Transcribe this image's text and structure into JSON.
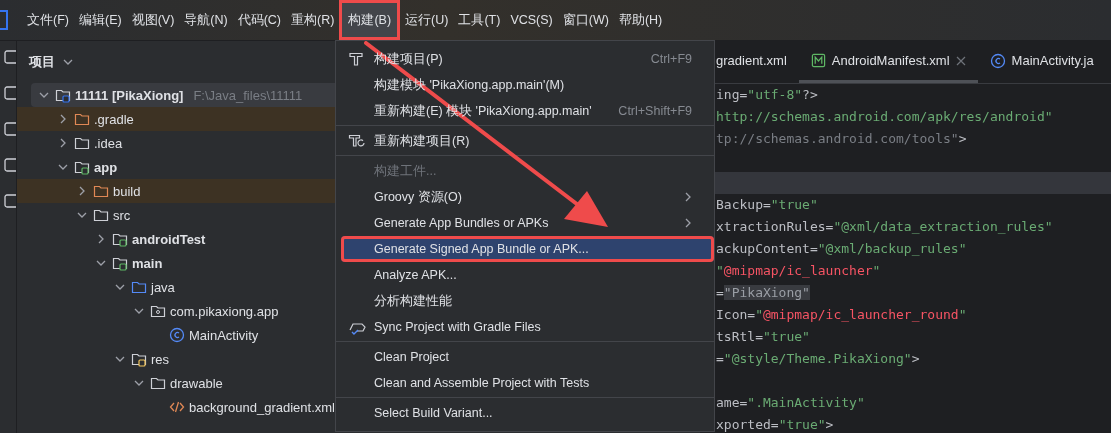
{
  "menubar": {
    "items": [
      {
        "label": "文件(F)",
        "selected": false,
        "annotated": false
      },
      {
        "label": "编辑(E)",
        "selected": false,
        "annotated": false
      },
      {
        "label": "视图(V)",
        "selected": false,
        "annotated": false
      },
      {
        "label": "导航(N)",
        "selected": false,
        "annotated": false
      },
      {
        "label": "代码(C)",
        "selected": false,
        "annotated": false
      },
      {
        "label": "重构(R)",
        "selected": false,
        "annotated": false
      },
      {
        "label": "构建(B)",
        "selected": true,
        "annotated": true
      },
      {
        "label": "运行(U)",
        "selected": false,
        "annotated": false
      },
      {
        "label": "工具(T)",
        "selected": false,
        "annotated": false
      },
      {
        "label": "VCS(S)",
        "selected": false,
        "annotated": false
      },
      {
        "label": "窗口(W)",
        "selected": false,
        "annotated": false
      },
      {
        "label": "帮助(H)",
        "selected": false,
        "annotated": false
      }
    ]
  },
  "project_panel": {
    "title": "项目",
    "tree": [
      {
        "label": "11111 [PikaXiong]",
        "path": "F:\\Java_files\\11111",
        "kind": "project",
        "bold": true,
        "expanded": true,
        "selected": true,
        "excluded": false,
        "children": [
          {
            "label": ".gradle",
            "kind": "folder",
            "bold": false,
            "expanded": false,
            "selected": false,
            "excluded": true
          },
          {
            "label": ".idea",
            "kind": "folder",
            "bold": false,
            "expanded": false,
            "selected": false,
            "excluded": false
          },
          {
            "label": "app",
            "kind": "module",
            "bold": true,
            "expanded": true,
            "selected": false,
            "excluded": false,
            "children": [
              {
                "label": "build",
                "kind": "folder",
                "bold": false,
                "expanded": false,
                "selected": false,
                "excluded": true
              },
              {
                "label": "src",
                "kind": "folder",
                "bold": false,
                "expanded": true,
                "selected": false,
                "excluded": false,
                "children": [
                  {
                    "label": "androidTest",
                    "kind": "module",
                    "bold": true,
                    "expanded": false,
                    "selected": false,
                    "excluded": false
                  },
                  {
                    "label": "main",
                    "kind": "module",
                    "bold": true,
                    "expanded": true,
                    "selected": false,
                    "excluded": false,
                    "children": [
                      {
                        "label": "java",
                        "kind": "source",
                        "bold": false,
                        "expanded": true,
                        "selected": false,
                        "excluded": false,
                        "children": [
                          {
                            "label": "com.pikaxiong.app",
                            "kind": "package",
                            "bold": false,
                            "expanded": true,
                            "selected": false,
                            "excluded": false,
                            "children": [
                              {
                                "label": "MainActivity",
                                "kind": "class",
                                "bold": false,
                                "selected": false,
                                "excluded": false
                              }
                            ]
                          }
                        ]
                      },
                      {
                        "label": "res",
                        "kind": "resources",
                        "bold": false,
                        "expanded": true,
                        "selected": false,
                        "excluded": false,
                        "children": [
                          {
                            "label": "drawable",
                            "kind": "folder",
                            "bold": false,
                            "expanded": true,
                            "selected": false,
                            "excluded": false,
                            "children": [
                              {
                                "label": "background_gradient.xml",
                                "kind": "xml",
                                "bold": false,
                                "selected": false,
                                "excluded": false
                              }
                            ]
                          }
                        ]
                      }
                    ]
                  }
                ]
              }
            ]
          }
        ]
      }
    ]
  },
  "editor": {
    "tabs": [
      {
        "label": "gradient.xml",
        "kind": "plain",
        "selected": false,
        "closable": false
      },
      {
        "label": "AndroidManifest.xml",
        "kind": "manifest",
        "selected": true,
        "closable": true
      },
      {
        "label": "MainActivity.ja",
        "kind": "class",
        "selected": false,
        "closable": false
      }
    ],
    "lines": [
      {
        "current": false,
        "segments": [
          {
            "kind": "attr",
            "text": "ing="
          },
          {
            "kind": "str",
            "text": "\"utf-8\""
          },
          {
            "kind": "punct",
            "text": "?>"
          }
        ]
      },
      {
        "current": false,
        "segments": [
          {
            "kind": "str",
            "text": "http://schemas.android.com/apk/res/android\""
          }
        ]
      },
      {
        "current": false,
        "segments": [
          {
            "kind": "unused",
            "text": "tp://schemas.android.com/tools\""
          },
          {
            "kind": "punct",
            "text": ">"
          }
        ]
      },
      {
        "current": false
      },
      {
        "current": true
      },
      {
        "current": false,
        "segments": [
          {
            "kind": "attr",
            "text": "Backup="
          },
          {
            "kind": "str",
            "text": "\"true\""
          }
        ]
      },
      {
        "current": false,
        "segments": [
          {
            "kind": "attr",
            "text": "xtractionRules="
          },
          {
            "kind": "str",
            "text": "\"@xml/data_extraction_rules\""
          }
        ]
      },
      {
        "current": false,
        "segments": [
          {
            "kind": "attr",
            "text": "ackupContent="
          },
          {
            "kind": "str",
            "text": "\"@xml/backup_rules\""
          }
        ]
      },
      {
        "current": false,
        "segments": [
          {
            "kind": "str",
            "text": "\""
          },
          {
            "kind": "ref",
            "text": "@mipmap/ic_launcher"
          },
          {
            "kind": "str",
            "text": "\""
          }
        ]
      },
      {
        "current": false,
        "segments": [
          {
            "kind": "attr",
            "text": "="
          },
          {
            "kind": "folded",
            "text": "\"PikaXiong\""
          }
        ]
      },
      {
        "current": false,
        "segments": [
          {
            "kind": "attr",
            "text": "Icon="
          },
          {
            "kind": "str",
            "text": "\""
          },
          {
            "kind": "ref",
            "text": "@mipmap/ic_launcher_round"
          },
          {
            "kind": "str",
            "text": "\""
          }
        ]
      },
      {
        "current": false,
        "segments": [
          {
            "kind": "attr",
            "text": "tsRtl="
          },
          {
            "kind": "str",
            "text": "\"true\""
          }
        ]
      },
      {
        "current": false,
        "segments": [
          {
            "kind": "attr",
            "text": "="
          },
          {
            "kind": "str",
            "text": "\"@style/Theme.PikaXiong\""
          },
          {
            "kind": "punct",
            "text": ">"
          }
        ]
      },
      {
        "current": false
      },
      {
        "current": false,
        "segments": [
          {
            "kind": "attr",
            "text": "ame="
          },
          {
            "kind": "str",
            "text": "\".MainActivity\""
          }
        ]
      },
      {
        "current": false,
        "segments": [
          {
            "kind": "attr",
            "text": "xported="
          },
          {
            "kind": "str",
            "text": "\"true\""
          },
          {
            "kind": "punct",
            "text": ">"
          }
        ]
      }
    ]
  },
  "build_menu": {
    "items": [
      {
        "kind": "build",
        "label": "构建项目(P)",
        "shortcut": "Ctrl+F9",
        "disabled": false,
        "submenu": false,
        "selected": false,
        "annotated": false
      },
      {
        "kind": "plain",
        "label": "构建模块 'PikaXiong.app.main'(M)",
        "disabled": false,
        "submenu": false,
        "selected": false,
        "annotated": false
      },
      {
        "kind": "plain",
        "label": "重新构建(E) 模块 'PikaXiong.app.main'",
        "shortcut": "Ctrl+Shift+F9",
        "disabled": false,
        "submenu": false,
        "selected": false,
        "annotated": false
      },
      {
        "kind": "separator"
      },
      {
        "kind": "rebuild",
        "label": "重新构建项目(R)",
        "disabled": false,
        "submenu": false,
        "selected": false,
        "annotated": false
      },
      {
        "kind": "separator"
      },
      {
        "kind": "plain",
        "label": "构建工件...",
        "disabled": true,
        "submenu": false,
        "selected": false,
        "annotated": false
      },
      {
        "kind": "plain",
        "label": "Groovy 资源(O)",
        "disabled": false,
        "submenu": true,
        "selected": false,
        "annotated": false
      },
      {
        "kind": "plain",
        "label": "Generate App Bundles or APKs",
        "disabled": false,
        "submenu": true,
        "selected": false,
        "annotated": false
      },
      {
        "kind": "plain",
        "label": "Generate Signed App Bundle or APK...",
        "disabled": false,
        "submenu": false,
        "selected": true,
        "annotated": true
      },
      {
        "kind": "plain",
        "label": "Analyze APK...",
        "disabled": false,
        "submenu": false,
        "selected": false,
        "annotated": false
      },
      {
        "kind": "plain",
        "label": "分析构建性能",
        "disabled": false,
        "submenu": false,
        "selected": false,
        "annotated": false
      },
      {
        "kind": "sync",
        "label": "Sync Project with Gradle Files",
        "disabled": false,
        "submenu": false,
        "selected": false,
        "annotated": false
      },
      {
        "kind": "separator"
      },
      {
        "kind": "plain",
        "label": "Clean Project",
        "disabled": false,
        "submenu": false,
        "selected": false,
        "annotated": false
      },
      {
        "kind": "plain",
        "label": "Clean and Assemble Project with Tests",
        "disabled": false,
        "submenu": false,
        "selected": false,
        "annotated": false
      },
      {
        "kind": "separator"
      },
      {
        "kind": "plain",
        "label": "Select Build Variant...",
        "disabled": false,
        "submenu": false,
        "selected": false,
        "annotated": false
      }
    ]
  }
}
